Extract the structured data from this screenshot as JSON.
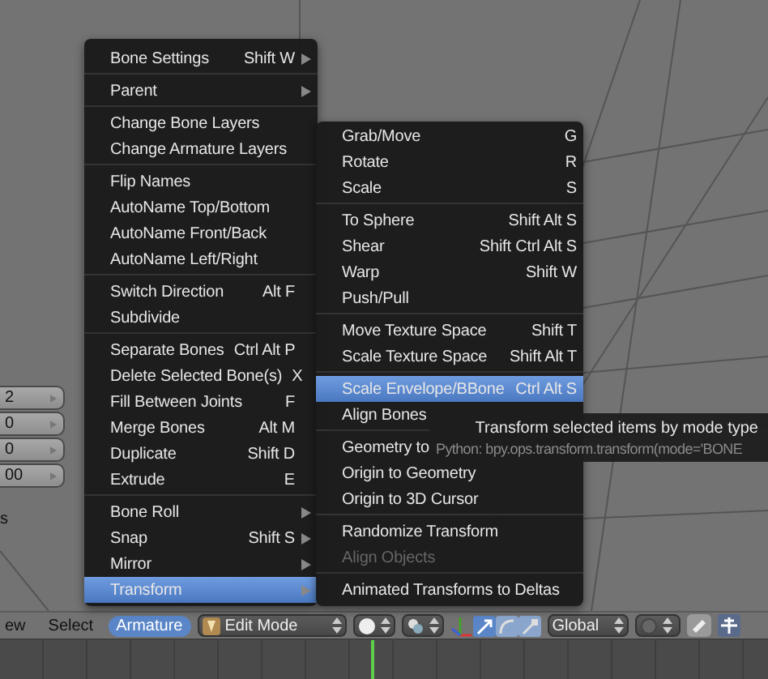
{
  "side_panel": {
    "fields": [
      "2",
      "0",
      "0",
      "00"
    ],
    "label": "s"
  },
  "armature_menu": {
    "groups": [
      [
        {
          "label": "Bone Settings",
          "shortcut": "Shift W",
          "submenu": true,
          "selected": false
        }
      ],
      [
        {
          "label": "Parent",
          "submenu": true,
          "selected": false
        }
      ],
      [
        {
          "label": "Change Bone Layers",
          "submenu": false,
          "selected": false
        },
        {
          "label": "Change Armature Layers",
          "submenu": false,
          "selected": false
        }
      ],
      [
        {
          "label": "Flip Names",
          "submenu": false,
          "selected": false
        },
        {
          "label": "AutoName Top/Bottom",
          "submenu": false,
          "selected": false
        },
        {
          "label": "AutoName Front/Back",
          "submenu": false,
          "selected": false
        },
        {
          "label": "AutoName Left/Right",
          "submenu": false,
          "selected": false
        }
      ],
      [
        {
          "label": "Switch Direction",
          "shortcut": "Alt F",
          "submenu": false,
          "selected": false
        },
        {
          "label": "Subdivide",
          "submenu": false,
          "selected": false
        }
      ],
      [
        {
          "label": "Separate Bones",
          "shortcut": "Ctrl Alt P",
          "submenu": false,
          "selected": false
        },
        {
          "label": "Delete Selected Bone(s)",
          "shortcut": "X",
          "submenu": false,
          "selected": false
        },
        {
          "label": "Fill Between Joints",
          "shortcut": "F",
          "submenu": false,
          "selected": false
        },
        {
          "label": "Merge Bones",
          "shortcut": "Alt M",
          "submenu": false,
          "selected": false
        },
        {
          "label": "Duplicate",
          "shortcut": "Shift D",
          "submenu": false,
          "selected": false
        },
        {
          "label": "Extrude",
          "shortcut": "E",
          "submenu": false,
          "selected": false
        }
      ],
      [
        {
          "label": "Bone Roll",
          "submenu": true,
          "selected": false
        },
        {
          "label": "Snap",
          "shortcut": "Shift S",
          "submenu": true,
          "selected": false
        },
        {
          "label": "Mirror",
          "submenu": true,
          "selected": false
        },
        {
          "label": "Transform",
          "submenu": true,
          "selected": true
        }
      ]
    ]
  },
  "transform_menu": {
    "groups": [
      [
        {
          "label": "Grab/Move",
          "shortcut": "G",
          "selected": false,
          "disabled": false
        },
        {
          "label": "Rotate",
          "shortcut": "R",
          "selected": false,
          "disabled": false
        },
        {
          "label": "Scale",
          "shortcut": "S",
          "selected": false,
          "disabled": false
        }
      ],
      [
        {
          "label": "To Sphere",
          "shortcut": "Shift Alt S",
          "selected": false,
          "disabled": false
        },
        {
          "label": "Shear",
          "shortcut": "Shift Ctrl Alt S",
          "selected": false,
          "disabled": false
        },
        {
          "label": "Warp",
          "shortcut": "Shift W",
          "selected": false,
          "disabled": false
        },
        {
          "label": "Push/Pull",
          "selected": false,
          "disabled": false
        }
      ],
      [
        {
          "label": "Move Texture Space",
          "shortcut": "Shift T",
          "selected": false,
          "disabled": false
        },
        {
          "label": "Scale Texture Space",
          "shortcut": "Shift Alt T",
          "selected": false,
          "disabled": false
        }
      ],
      [
        {
          "label": "Scale Envelope/BBone",
          "shortcut": "Ctrl Alt S",
          "selected": true,
          "disabled": false
        },
        {
          "label": "Align Bones",
          "selected": false,
          "disabled": false
        }
      ],
      [
        {
          "label": "Geometry to",
          "selected": false,
          "disabled": false
        },
        {
          "label": "Origin to Geometry",
          "selected": false,
          "disabled": false
        },
        {
          "label": "Origin to 3D Cursor",
          "selected": false,
          "disabled": false
        }
      ],
      [
        {
          "label": "Randomize Transform",
          "selected": false,
          "disabled": false
        },
        {
          "label": "Align Objects",
          "selected": false,
          "disabled": true
        }
      ],
      [
        {
          "label": "Animated Transforms to Deltas",
          "selected": false,
          "disabled": false
        }
      ]
    ]
  },
  "tooltip": {
    "text": "Transform selected items by mode type",
    "python": "Python: bpy.ops.transform.transform(mode='BONE"
  },
  "header": {
    "menus": [
      {
        "label": "ew",
        "selected": false
      },
      {
        "label": "Select",
        "selected": false
      },
      {
        "label": "Armature",
        "selected": true
      }
    ],
    "mode": "Edit Mode",
    "orientation": "Global"
  }
}
